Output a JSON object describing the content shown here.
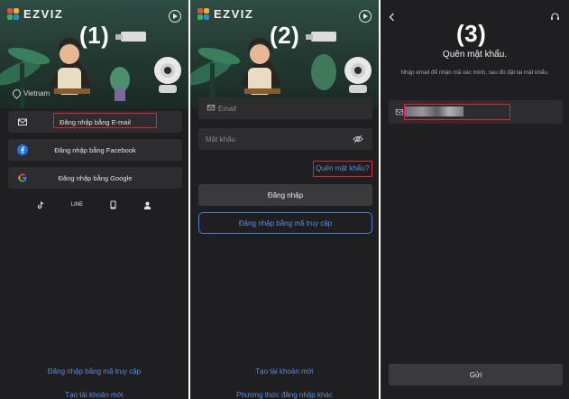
{
  "colors": {
    "panel_bg": "#1f1f21",
    "row_bg": "#2d2d30",
    "highlight_box": "#e3232e",
    "link": "#5a8fd8"
  },
  "panel1": {
    "step": "(1)",
    "brand": "EZVIZ",
    "region": "Vietnam",
    "login_email": "Đăng nhập bằng E-mail",
    "login_facebook": "Đăng nhập bằng Facebook",
    "login_google": "Đăng nhập bằng Google",
    "social_line": "LINE",
    "link_access_code": "Đăng nhập bằng mã truy cập",
    "link_create_account": "Tạo tài khoản mới",
    "icons": [
      "play-icon",
      "location-pin-icon",
      "mail-icon",
      "facebook-icon",
      "google-icon",
      "tiktok-icon",
      "line-icon",
      "phone-icon",
      "person-icon"
    ]
  },
  "panel2": {
    "step": "(2)",
    "brand": "EZVIZ",
    "email_placeholder": "Email",
    "password_placeholder": "Mật khẩu",
    "forgot_password": "Quên mật khẩu?",
    "login_button": "Đăng nhập",
    "access_code_button": "Đăng nhập bằng mã truy cập",
    "link_create_account": "Tạo tài khoản mới",
    "link_other_methods": "Phương thức đăng nhập khác"
  },
  "panel3": {
    "step": "(3)",
    "title": "Quên mật khẩu.",
    "subtitle": "Nhập email để nhận mã xác minh, sau đó đặt lại mật khẩu.",
    "send_button": "Gửi"
  }
}
